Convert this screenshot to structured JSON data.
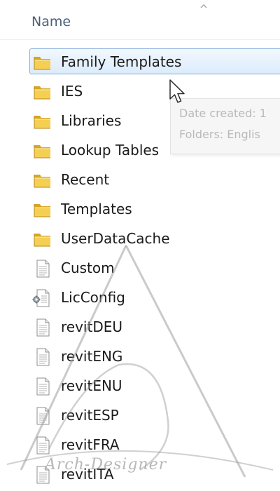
{
  "header": {
    "name_column": "Name"
  },
  "files": [
    {
      "label": "Family Templates",
      "icon": "folder-icon",
      "selected": true
    },
    {
      "label": "IES",
      "icon": "folder-icon",
      "selected": false
    },
    {
      "label": "Libraries",
      "icon": "folder-icon",
      "selected": false
    },
    {
      "label": "Lookup Tables",
      "icon": "folder-icon",
      "selected": false
    },
    {
      "label": "Recent",
      "icon": "folder-icon",
      "selected": false
    },
    {
      "label": "Templates",
      "icon": "folder-icon",
      "selected": false
    },
    {
      "label": "UserDataCache",
      "icon": "folder-icon",
      "selected": false
    },
    {
      "label": "Custom",
      "icon": "text-file-icon",
      "selected": false
    },
    {
      "label": "LicConfig",
      "icon": "config-file-icon",
      "selected": false
    },
    {
      "label": "revitDEU",
      "icon": "text-file-icon",
      "selected": false
    },
    {
      "label": "revitENG",
      "icon": "text-file-icon",
      "selected": false
    },
    {
      "label": "revitENU",
      "icon": "text-file-icon",
      "selected": false
    },
    {
      "label": "revitESP",
      "icon": "text-file-icon",
      "selected": false
    },
    {
      "label": "revitFRA",
      "icon": "text-file-icon",
      "selected": false
    },
    {
      "label": "revitITA",
      "icon": "text-file-icon",
      "selected": false
    }
  ],
  "tooltip": {
    "line1": "Date created: 1",
    "line2": "Folders: Englis"
  },
  "watermark": {
    "text": "Arch-Designer"
  },
  "colors": {
    "selection_border": "#84acdd",
    "selection_fill": "#dcebfb",
    "header_text": "#4c607a",
    "folder": "#e8b832"
  }
}
